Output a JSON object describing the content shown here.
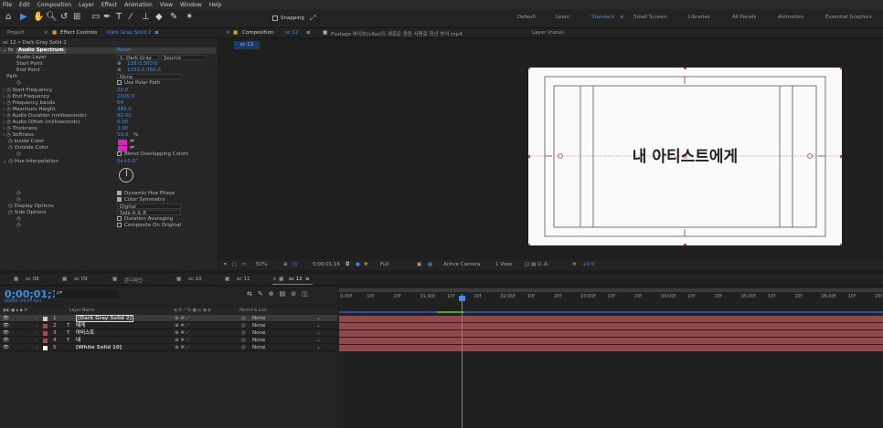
{
  "menu": [
    "File",
    "Edit",
    "Composition",
    "Layer",
    "Effect",
    "Animation",
    "View",
    "Window",
    "Help"
  ],
  "toolbar": {
    "snapping": "Snapping"
  },
  "workspaces": {
    "items": [
      "Default",
      "Learn",
      "Standard",
      "Small Screen",
      "Libraries",
      "All Panels",
      "Animation",
      "Essential Graphics"
    ],
    "active": "Standard"
  },
  "project_tab": "Project",
  "effect_controls": {
    "tab_prefix": "Effect Controls",
    "tab_layer": "Dark Gray Solid 2",
    "breadcrumb": "sc 12 • Dark Gray Solid 2",
    "effect_name": "Audio Spectrum",
    "reset": "Reset",
    "rows": [
      {
        "label": "Audio Layer",
        "value": "1. Dark Gray",
        "value2": "Source"
      },
      {
        "label": "Start Point",
        "value": "128.0,360.0"
      },
      {
        "label": "End Point",
        "value": "1152.0,360.0"
      },
      {
        "label": "Path",
        "value": "None"
      },
      {
        "label": "Use Polar Path"
      },
      {
        "label": "Start Frequency",
        "value": "20.0"
      },
      {
        "label": "End Frequency",
        "value": "2000.0"
      },
      {
        "label": "Frequency bands",
        "value": "64"
      },
      {
        "label": "Maximum Height",
        "value": "480.0"
      },
      {
        "label": "Audio Duration (milliseconds)",
        "value": "90.00"
      },
      {
        "label": "Audio Offset (milliseconds)",
        "value": "0.00"
      },
      {
        "label": "Thickness",
        "value": "3.00"
      },
      {
        "label": "Softness",
        "value": "50.0",
        "unit": "%"
      },
      {
        "label": "Inside Color"
      },
      {
        "label": "Outside Color"
      },
      {
        "label": "Blend Overlapping Colors"
      },
      {
        "label": "Hue Interpolation",
        "value": "0x+0.0°"
      },
      {
        "label": "Dynamic Hue Phase"
      },
      {
        "label": "Color Symmetry"
      },
      {
        "label": "Display Options",
        "value": "Digital"
      },
      {
        "label": "Side Options",
        "value": "Side A & B"
      },
      {
        "label": "Duration Averaging"
      },
      {
        "label": "Composite On Original"
      }
    ],
    "colors": {
      "inside": "#e020c0",
      "outside": "#e020c0"
    }
  },
  "composition": {
    "tab_prefix": "Composition",
    "tab_name": "sc 12",
    "footage_tab": "Footage 바이브(vibe)의 새로운 동원 사용료 정산 방식.mp4",
    "layer_tab": "Layer (none)",
    "sub_tab": "sc 12",
    "title_text": "내 아티스트에게",
    "footer": {
      "zoom": "50%",
      "timecode": "0;00;01;16",
      "resolution": "Full",
      "camera": "Active Camera",
      "views": "1 View",
      "exposure": "+0.0"
    }
  },
  "timeline": {
    "tabs": [
      "sc 08",
      "sc 09",
      "콘디자인",
      "sc 10",
      "sc 11",
      "sc 12"
    ],
    "active_tab": "sc 12",
    "timecode": "0;00;01;16",
    "frame_info": "00046 (29.97 fps)",
    "search_placeholder": "ρ▾",
    "headers": {
      "layer_name": "Layer Name",
      "parent": "Parent & Link"
    },
    "layers": [
      {
        "num": "1",
        "type": "",
        "name": "[Dark Gray Solid 2]",
        "parent": "None",
        "color": "#d0d0d0"
      },
      {
        "num": "2",
        "type": "T",
        "name": "에게",
        "parent": "None",
        "color": "#c83c3c"
      },
      {
        "num": "3",
        "type": "T",
        "name": "아티스트",
        "parent": "None",
        "color": "#c83c3c"
      },
      {
        "num": "4",
        "type": "T",
        "name": "내",
        "parent": "None",
        "color": "#c83c3c"
      },
      {
        "num": "5",
        "type": "",
        "name": "[White Solid 10]",
        "parent": "None",
        "color": "#ffffff"
      }
    ],
    "ruler": [
      "0;00f",
      "10f",
      "20f",
      "01;00f",
      "10f",
      "20f",
      "02;00f",
      "10f",
      "20f",
      "03;00f",
      "10f",
      "20f",
      "04;00f",
      "10f",
      "20f",
      "05;00f",
      "10f",
      "20f",
      "06;00f",
      "10f",
      "20f"
    ]
  },
  "accent": "#2f7fe6"
}
